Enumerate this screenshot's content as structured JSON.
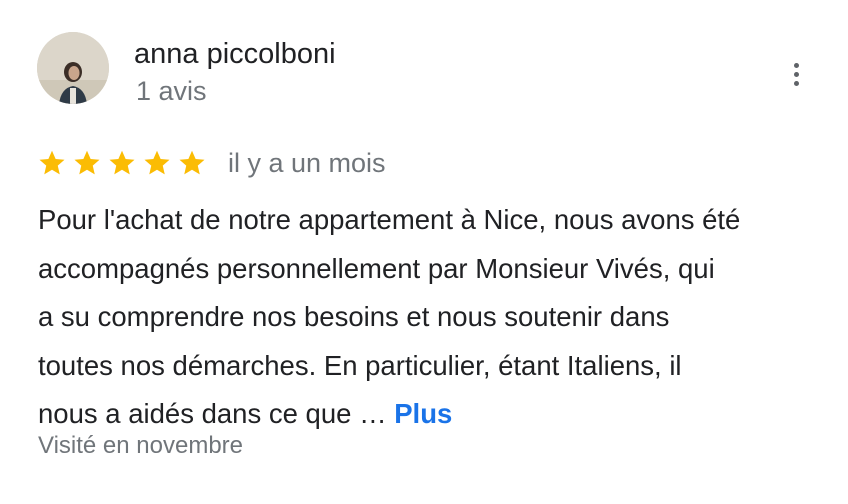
{
  "author": {
    "name": "anna piccolboni",
    "reviews_count": "1 avis"
  },
  "review": {
    "rating": 5,
    "max_rating": 5,
    "star_color": "#fbbc04",
    "date": "il y a un mois",
    "text_lines": [
      "Pour l'achat de notre appartement à Nice, nous avons été",
      "accompagnés personnellement par Monsieur Vivés, qui",
      "a su comprendre nos besoins et nous soutenir dans",
      "toutes nos démarches. En particulier, étant Italiens, il",
      "nous a aidés dans ce que …"
    ],
    "more_label": "Plus",
    "visited": "Visité en novembre"
  },
  "icons": {
    "menu": "more-vert-icon",
    "star": "star-icon"
  },
  "colors": {
    "link": "#1a73e8",
    "secondary_text": "#70757a",
    "primary_text": "#202124"
  }
}
